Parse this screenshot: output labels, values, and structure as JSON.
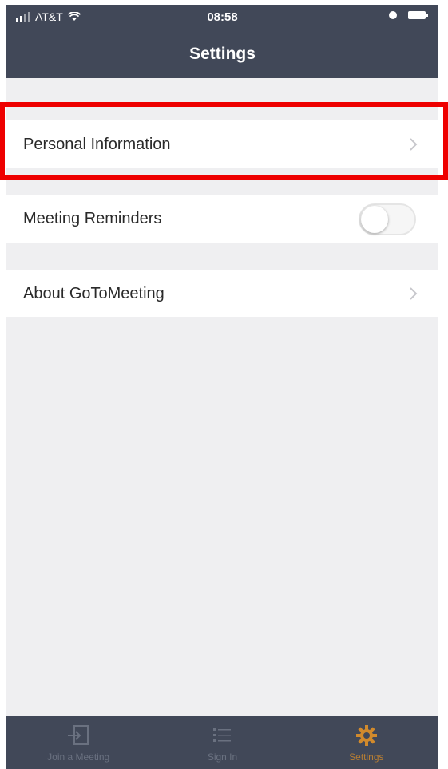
{
  "status_bar": {
    "carrier": "AT&T",
    "time": "08:58"
  },
  "header": {
    "title": "Settings"
  },
  "settings": {
    "personal_information": "Personal Information",
    "meeting_reminders": "Meeting Reminders",
    "meeting_reminders_enabled": false,
    "about": "About GoToMeeting"
  },
  "tabs": [
    {
      "label": "Join a Meeting",
      "icon": "join-meeting-icon",
      "active": false
    },
    {
      "label": "Sign In",
      "icon": "list-icon",
      "active": false
    },
    {
      "label": "Settings",
      "icon": "gear-icon",
      "active": true
    }
  ],
  "colors": {
    "header_bg": "#414858",
    "highlight": "#ee0000",
    "active_tab": "#b77e33"
  }
}
